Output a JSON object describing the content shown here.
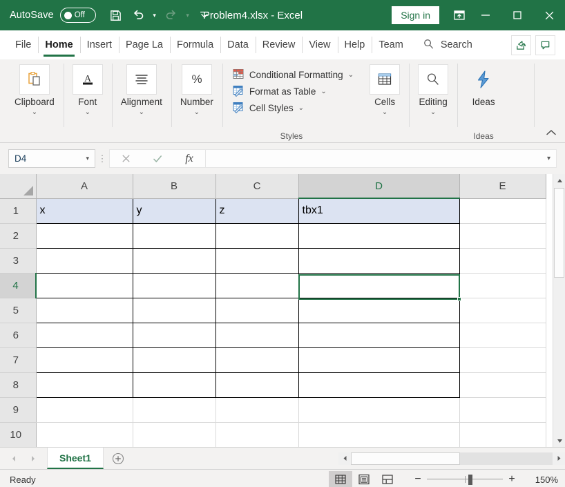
{
  "titlebar": {
    "autosave_label": "AutoSave",
    "autosave_state": "Off",
    "save_icon": "save-icon",
    "undo_icon": "undo-icon",
    "redo_icon": "redo-icon",
    "customize_icon": "customize-quick-access-toolbar-icon",
    "document_title": "Problem4.xlsx  -  Excel",
    "signin_label": "Sign in",
    "ribbon_display_icon": "ribbon-display-options-icon",
    "minimize_icon": "minimize-icon",
    "restore_icon": "restore-icon",
    "close_icon": "close-icon"
  },
  "ribbon_tabs": {
    "tabs": [
      {
        "label": "File",
        "active": false
      },
      {
        "label": "Home",
        "active": true
      },
      {
        "label": "Insert",
        "active": false
      },
      {
        "label": "Page La",
        "active": false
      },
      {
        "label": "Formula",
        "active": false
      },
      {
        "label": "Data",
        "active": false
      },
      {
        "label": "Review",
        "active": false
      },
      {
        "label": "View",
        "active": false
      },
      {
        "label": "Help",
        "active": false
      },
      {
        "label": "Team",
        "active": false
      }
    ],
    "search_placeholder": "Search",
    "share_icon": "share-icon",
    "comments_icon": "comment-icon"
  },
  "ribbon": {
    "groups": [
      {
        "label": "Clipboard",
        "icon": "clipboard-icon",
        "caret": "⌄"
      },
      {
        "label": "Font",
        "icon": "font-icon",
        "caret": "⌄"
      },
      {
        "label": "Alignment",
        "icon": "alignment-icon",
        "caret": "⌄"
      },
      {
        "label": "Number",
        "icon": "percent-icon",
        "caret": "⌄"
      }
    ],
    "styles": {
      "caption": "Styles",
      "items": [
        {
          "label": "Conditional Formatting",
          "icon": "conditional-formatting-icon",
          "caret": "⌄"
        },
        {
          "label": "Format as Table",
          "icon": "format-as-table-icon",
          "caret": "⌄"
        },
        {
          "label": "Cell Styles",
          "icon": "cell-styles-icon",
          "caret": "⌄"
        }
      ]
    },
    "cells": {
      "label": "Cells",
      "icon": "cells-icon",
      "caret": "⌄"
    },
    "editing": {
      "label": "Editing",
      "icon": "editing-search-icon",
      "caret": "⌄"
    },
    "ideas": {
      "label": "Ideas",
      "caption": "Ideas",
      "icon": "ideas-lightning-icon"
    },
    "collapse_icon": "collapse-ribbon-icon"
  },
  "formula_bar": {
    "namebox_value": "D4",
    "namebox_caret": "▾",
    "cancel_icon": "cancel-icon",
    "enter_icon": "enter-checkmark-icon",
    "function_icon": "insert-function-icon",
    "formula_value": "",
    "expand_caret": "⌄"
  },
  "grid": {
    "columns": [
      "A",
      "B",
      "C",
      "D",
      "E"
    ],
    "selected_column": "D",
    "rows": [
      "1",
      "2",
      "3",
      "4",
      "5",
      "6",
      "7",
      "8",
      "9",
      "10"
    ],
    "selected_row": "4",
    "cells": {
      "A1": "x",
      "B1": "y",
      "C1": "z",
      "D1": "tbx1"
    },
    "active_cell": "D4"
  },
  "sheet_tabs": {
    "prev_icon": "previous-sheet-icon",
    "next_icon": "next-sheet-icon",
    "sheets": [
      {
        "name": "Sheet1",
        "active": true
      }
    ],
    "add_sheet_icon": "add-sheet-icon"
  },
  "statusbar": {
    "status_text": "Ready",
    "views": [
      {
        "name": "normal-view-icon",
        "active": true
      },
      {
        "name": "page-layout-view-icon",
        "active": false
      },
      {
        "name": "page-break-preview-icon",
        "active": false
      }
    ],
    "zoom_out_label": "−",
    "zoom_in_label": "+",
    "zoom_level": "150%"
  },
  "colors": {
    "excel_green": "#217346",
    "selection_fill": "#dce3f2",
    "header_gray": "#e6e6e6"
  }
}
